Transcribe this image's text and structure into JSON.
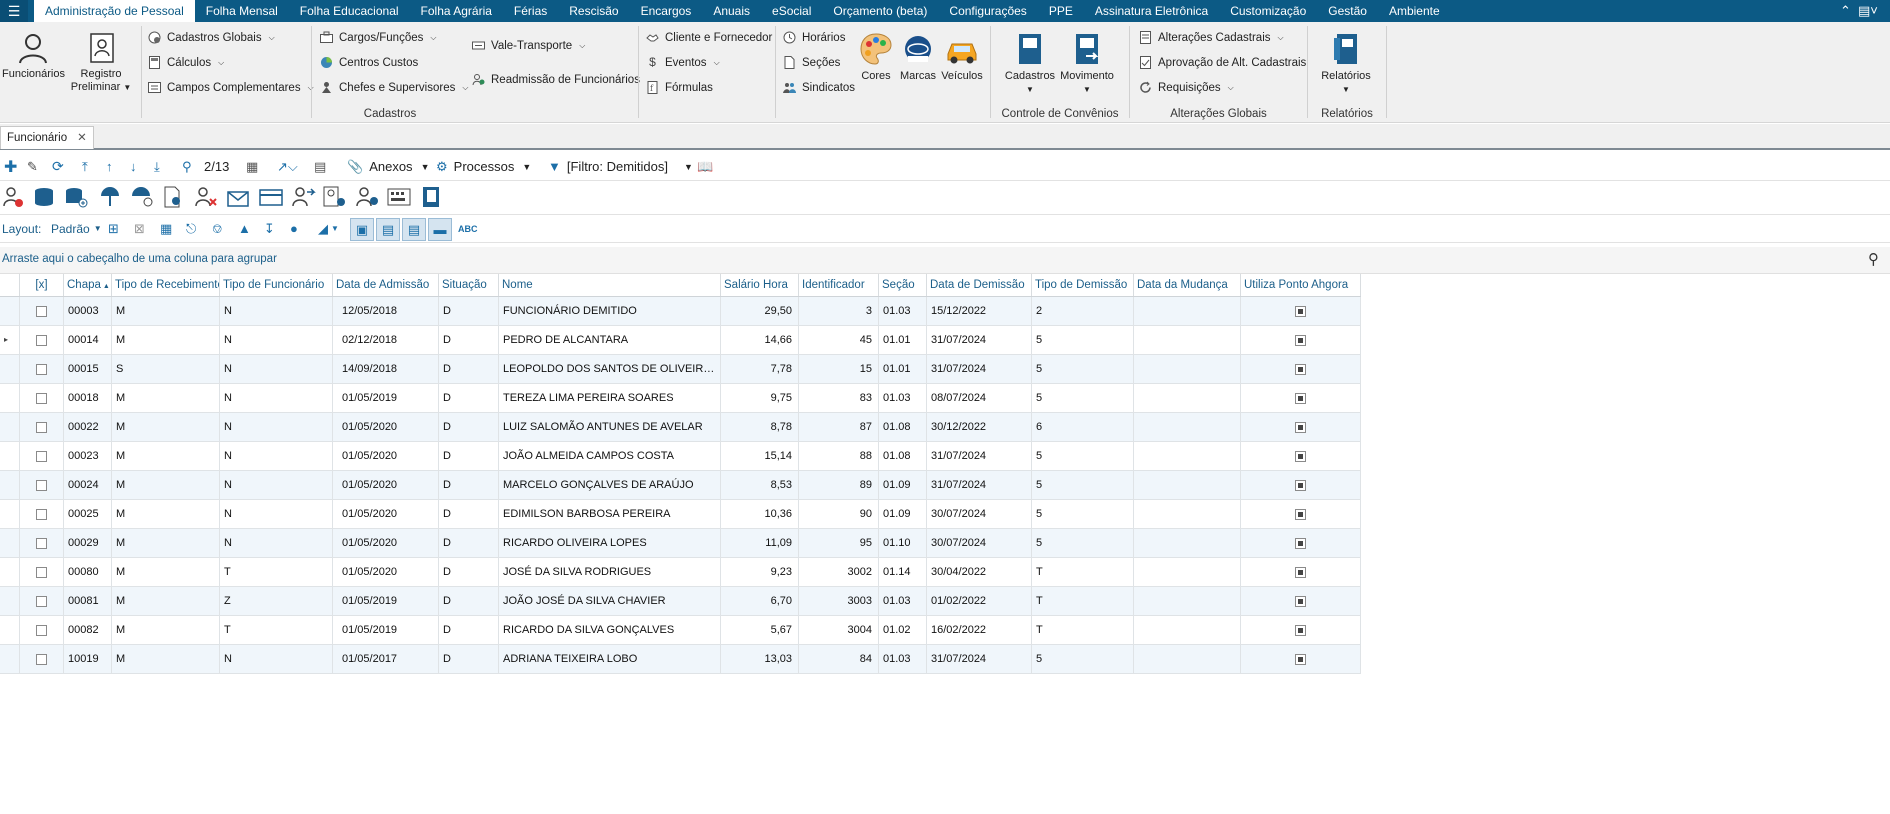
{
  "menu": {
    "tabs": [
      "Administração de Pessoal",
      "Folha Mensal",
      "Folha Educacional",
      "Folha Agrária",
      "Férias",
      "Rescisão",
      "Encargos",
      "Anuais",
      "eSocial",
      "Orçamento (beta)",
      "Configurações",
      "PPE",
      "Assinatura Eletrônica",
      "Customização",
      "Gestão",
      "Ambiente"
    ],
    "active_index": 0
  },
  "ribbon": {
    "funcionarios": "Funcionários",
    "registro_l1": "Registro",
    "registro_l2": "Preliminar",
    "cadastros_globais": "Cadastros Globais",
    "calculos": "Cálculos",
    "campos_complementares": "Campos Complementares",
    "cargos_funcoes": "Cargos/Funções",
    "centros_custos": "Centros Custos",
    "chefes_supervisores": "Chefes e Supervisores",
    "vale_transporte": "Vale-Transporte",
    "readmissao": "Readmissão de Funcionários",
    "cliente_fornecedor": "Cliente e Fornecedor",
    "eventos": "Eventos",
    "formulas": "Fórmulas",
    "horarios": "Horários",
    "secoes": "Seções",
    "sindicatos": "Sindicatos",
    "cores": "Cores",
    "marcas": "Marcas",
    "veiculos": "Veículos",
    "cadastros_btn": "Cadastros",
    "movimento_btn": "Movimento",
    "alteracoes_cadastrais": "Alterações Cadastrais",
    "aprovacao": "Aprovação de Alt. Cadastrais",
    "requisicoes": "Requisições",
    "relatorios_btn": "Relatórios",
    "group_cadastros": "Cadastros",
    "group_convenios": "Controle de Convênios",
    "group_alteracoes": "Alterações Globais",
    "group_relatorios": "Relatórios"
  },
  "doc_tab": {
    "label": "Funcionário"
  },
  "toolbar": {
    "record_pos": "2/13",
    "anexos": "Anexos",
    "processos": "Processos",
    "filtro": "[Filtro: Demitidos]"
  },
  "layout_bar": {
    "label": "Layout:",
    "value": "Padrão"
  },
  "group_hint": "Arraste aqui o cabeçalho de uma coluna para agrupar",
  "grid": {
    "select_header": "[x]",
    "columns": [
      "Chapa",
      "Tipo de Recebimento",
      "Tipo de Funcionário",
      "Data de Admissão",
      "Situação",
      "Nome",
      "Salário Hora",
      "Identificador",
      "Seção",
      "Data de Demissão",
      "Tipo de Demissão",
      "Data da Mudança",
      "Utiliza Ponto Ahgora"
    ],
    "current_row": 1,
    "rows": [
      [
        "00003",
        "M",
        "N",
        "12/05/2018",
        "D",
        "FUNCIONÁRIO DEMITIDO",
        "29,50",
        "3",
        "01.03",
        "15/12/2022",
        "2",
        ""
      ],
      [
        "00014",
        "M",
        "N",
        "02/12/2018",
        "D",
        "PEDRO DE ALCANTARA",
        "14,66",
        "45",
        "01.01",
        "31/07/2024",
        "5",
        ""
      ],
      [
        "00015",
        "S",
        "N",
        "14/09/2018",
        "D",
        "LEOPOLDO DOS SANTOS DE OLIVEIRA N...",
        "7,78",
        "15",
        "01.01",
        "31/07/2024",
        "5",
        ""
      ],
      [
        "00018",
        "M",
        "N",
        "01/05/2019",
        "D",
        "TEREZA LIMA PEREIRA SOARES",
        "9,75",
        "83",
        "01.03",
        "08/07/2024",
        "5",
        ""
      ],
      [
        "00022",
        "M",
        "N",
        "01/05/2020",
        "D",
        "LUIZ SALOMÃO ANTUNES DE AVELAR",
        "8,78",
        "87",
        "01.08",
        "30/12/2022",
        "6",
        ""
      ],
      [
        "00023",
        "M",
        "N",
        "01/05/2020",
        "D",
        "JOÃO ALMEIDA CAMPOS COSTA",
        "15,14",
        "88",
        "01.08",
        "31/07/2024",
        "5",
        ""
      ],
      [
        "00024",
        "M",
        "N",
        "01/05/2020",
        "D",
        "MARCELO GONÇALVES DE ARAÚJO",
        "8,53",
        "89",
        "01.09",
        "31/07/2024",
        "5",
        ""
      ],
      [
        "00025",
        "M",
        "N",
        "01/05/2020",
        "D",
        "EDIMILSON BARBOSA PEREIRA",
        "10,36",
        "90",
        "01.09",
        "30/07/2024",
        "5",
        ""
      ],
      [
        "00029",
        "M",
        "N",
        "01/05/2020",
        "D",
        "RICARDO OLIVEIRA LOPES",
        "11,09",
        "95",
        "01.10",
        "30/07/2024",
        "5",
        ""
      ],
      [
        "00080",
        "M",
        "T",
        "01/05/2020",
        "D",
        "JOSÉ DA SILVA RODRIGUES",
        "9,23",
        "3002",
        "01.14",
        "30/04/2022",
        "T",
        ""
      ],
      [
        "00081",
        "M",
        "Z",
        "01/05/2019",
        "D",
        "JOÃO JOSÉ DA SILVA CHAVIER",
        "6,70",
        "3003",
        "01.03",
        "01/02/2022",
        "T",
        ""
      ],
      [
        "00082",
        "M",
        "T",
        "01/05/2019",
        "D",
        "RICARDO DA SILVA GONÇALVES",
        "5,67",
        "3004",
        "01.02",
        "16/02/2022",
        "T",
        ""
      ],
      [
        "10019",
        "M",
        "N",
        "01/05/2017",
        "D",
        "ADRIANA TEIXEIRA LOBO",
        "13,03",
        "84",
        "01.03",
        "31/07/2024",
        "5",
        ""
      ]
    ]
  }
}
